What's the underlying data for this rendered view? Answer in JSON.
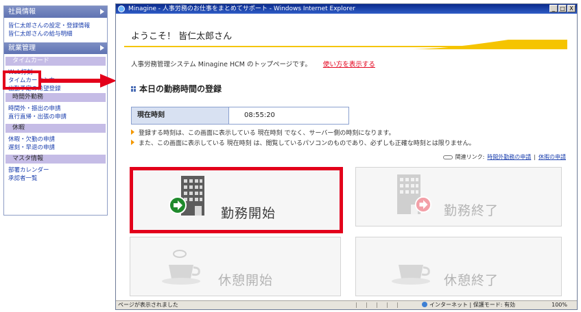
{
  "sidebar": {
    "employee_section": "社員情報",
    "employee_links": [
      "皆仁太郎さんの設定・登録情報",
      "皆仁太郎さんの給与明細"
    ],
    "work_section": "就業管理",
    "timecard_sub": "タイムカード",
    "timecard_links": [
      "Web打刻",
      "タイムカード入力",
      "出勤予定の希望登録"
    ],
    "overtime_sub": "時間外勤務",
    "overtime_links": [
      "時間外・振出の申請",
      "直行直帰・出張の申請"
    ],
    "leave_sub": "休暇",
    "leave_links": [
      "休暇・欠勤の申請",
      "遅刻・早退の申請"
    ],
    "master_sub": "マスタ情報",
    "master_links": [
      "部署カレンダー",
      "承認者一覧"
    ]
  },
  "browser": {
    "title": "Minagine - 人事労務のお仕事をまとめてサポート - Windows Internet Explorer",
    "min": "_",
    "max": "□",
    "close": "X"
  },
  "page": {
    "welcome": "ようこそ！ 皆仁太郎さん",
    "intro": "人事労務管理システム Minagine HCM のトップページです。",
    "help_link": "使い方を表示する",
    "section_title": "本日の勤務時間の登録",
    "current_time_label": "現在時刻",
    "current_time_value": "08:55:20",
    "note1": "登録する時刻は、この画面に表示している 現在時刻 でなく、サーバー側の時刻になります。",
    "note2": "また、この画面に表示している 現在時刻 は、閲覧しているパソコンのものであり、必ずしも正確な時刻とは限りません。",
    "related_label": "関連リンク:",
    "related_links": [
      "時間外勤務の申請",
      "休暇の申請"
    ],
    "related_sep": "|",
    "buttons": {
      "work_start": "勤務開始",
      "work_end": "勤務終了",
      "break_start": "休憩開始",
      "break_end": "休憩終了"
    }
  },
  "status_bar": {
    "left": "ページが表示されました",
    "zone": "インターネット | 保護モード: 有効",
    "zoom": "100%"
  },
  "colors": {
    "annotation_red": "#e3001b",
    "sidebar_header": "#6a7dbb",
    "sidebar_sub": "#c5bce6",
    "link_blue": "#1b3fae",
    "accent_yellow": "#f5c400",
    "start_green": "#1f8a2c",
    "end_pink": "#f3a0a8"
  }
}
